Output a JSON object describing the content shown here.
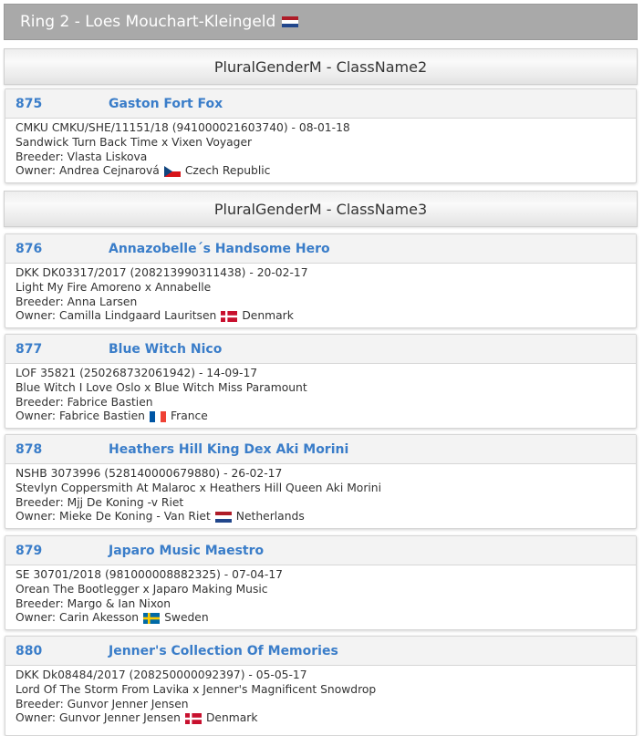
{
  "ring": {
    "title": "Ring 2 - Loes Mouchart-Kleingeld",
    "flag": "NL"
  },
  "classes": [
    {
      "title": "PluralGenderM - ClassName2"
    },
    {
      "title": "PluralGenderM - ClassName3"
    }
  ],
  "dogs": [
    {
      "number": "875",
      "name": "Gaston Fort Fox",
      "registration": "CMKU CMKU/SHE/11151/18 (941000021603740) - 08-01-18",
      "parents": "Sandwick Turn Back Time x Vixen Voyager",
      "breeder": "Breeder: Vlasta Liskova",
      "owner": "Owner: Andrea Cejnarová",
      "country": "Czech Republic",
      "flag": "CZ"
    },
    {
      "number": "876",
      "name": "Annazobelle´s Handsome Hero",
      "registration": "DKK DK03317/2017 (208213990311438) - 20-02-17",
      "parents": "Light My Fire Amoreno x Annabelle",
      "breeder": "Breeder: Anna Larsen",
      "owner": "Owner: Camilla Lindgaard Lauritsen",
      "country": "Denmark",
      "flag": "DK"
    },
    {
      "number": "877",
      "name": "Blue Witch Nico",
      "registration": "LOF 35821 (250268732061942) - 14-09-17",
      "parents": "Blue Witch I Love Oslo x Blue Witch Miss Paramount",
      "breeder": "Breeder: Fabrice Bastien",
      "owner": "Owner: Fabrice Bastien",
      "country": "France",
      "flag": "FR"
    },
    {
      "number": "878",
      "name": "Heathers Hill King Dex Aki Morini",
      "registration": "NSHB 3073996 (528140000679880) - 26-02-17",
      "parents": "Stevlyn Coppersmith At Malaroc x Heathers Hill Queen Aki Morini",
      "breeder": "Breeder: Mjj De Koning -v Riet",
      "owner": "Owner: Mieke De Koning - Van Riet",
      "country": "Netherlands",
      "flag": "NL"
    },
    {
      "number": "879",
      "name": "Japaro Music Maestro",
      "registration": "SE 30701/2018 (981000008882325) - 07-04-17",
      "parents": "Orean The Bootlegger x Japaro Making Music",
      "breeder": "Breeder: Margo & Ian Nixon",
      "owner": "Owner: Carin Akesson",
      "country": "Sweden",
      "flag": "SE"
    },
    {
      "number": "880",
      "name": "Jenner's Collection Of Memories",
      "registration": "DKK Dk08484/2017 (208250000092397) - 05-05-17",
      "parents": "Lord Of The Storm From Lavika x Jenner's Magnificent Snowdrop",
      "breeder": "Breeder: Gunvor Jenner Jensen",
      "owner": "Owner: Gunvor Jenner Jensen",
      "country": "Denmark",
      "flag": "DK"
    }
  ]
}
